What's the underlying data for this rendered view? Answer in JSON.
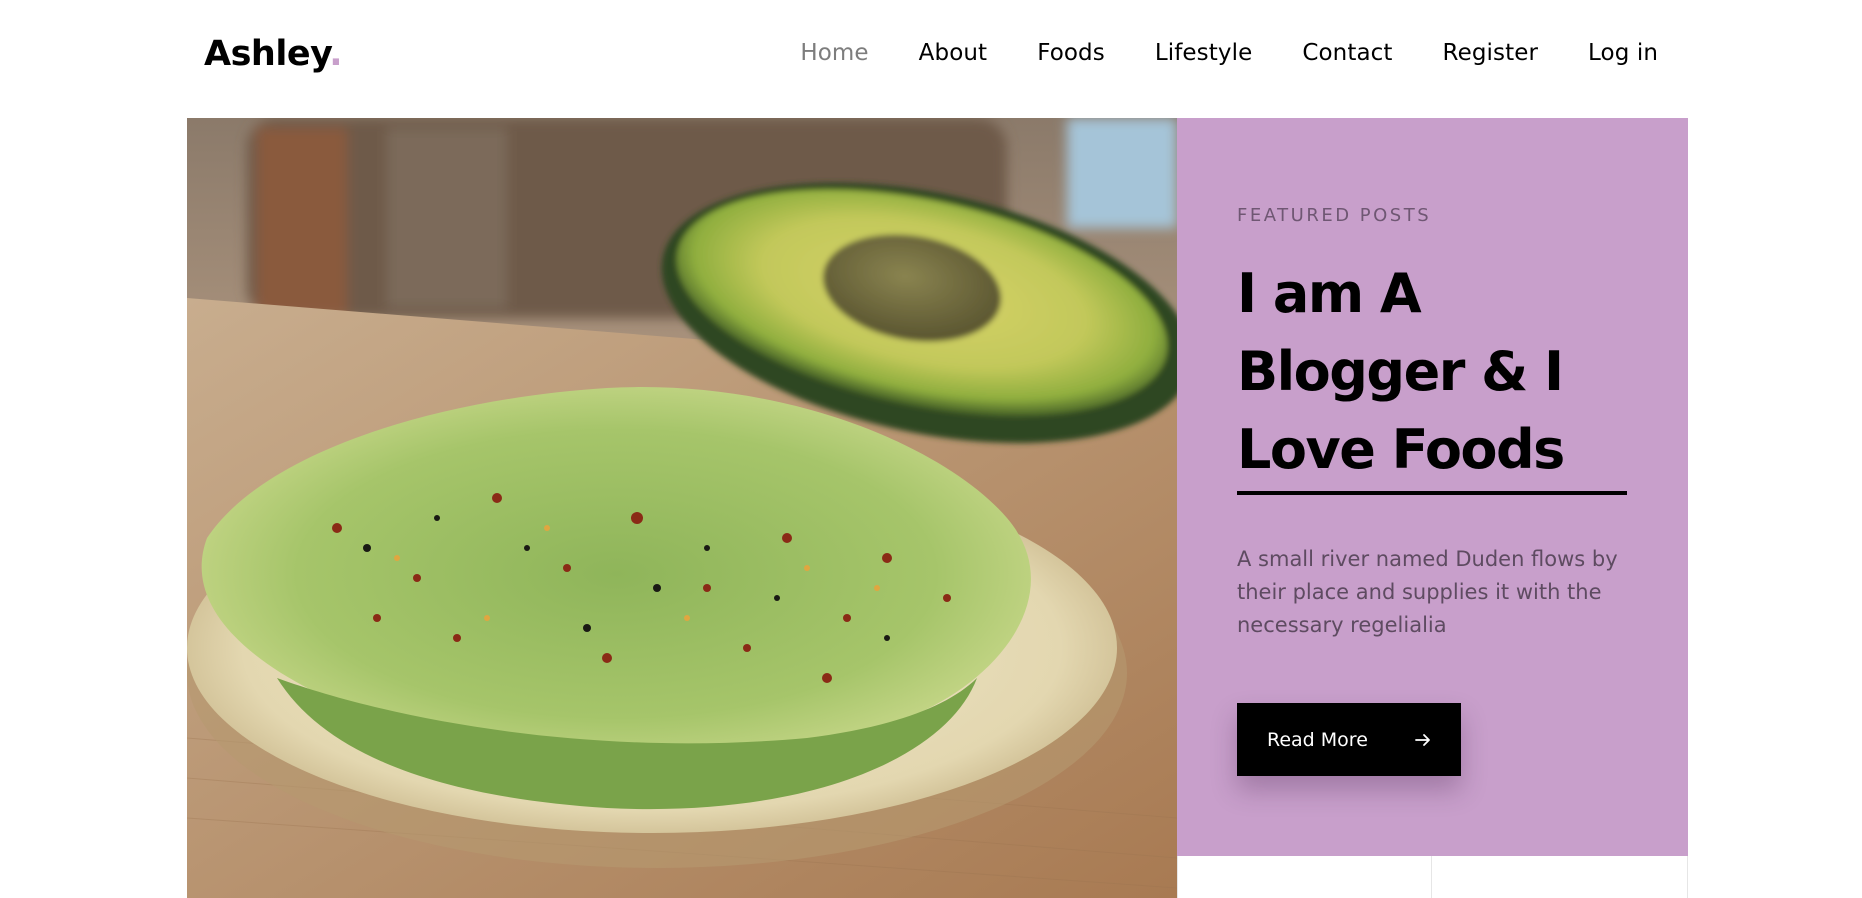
{
  "brand": {
    "name": "Ashley",
    "dot": ".",
    "accent_color": "#c89fcb"
  },
  "nav": {
    "items": [
      {
        "label": "Home",
        "active": true
      },
      {
        "label": "About"
      },
      {
        "label": "Foods"
      },
      {
        "label": "Lifestyle"
      },
      {
        "label": "Contact"
      },
      {
        "label": "Register"
      },
      {
        "label": "Log in"
      }
    ]
  },
  "hero": {
    "image_icon": "avocado-toast-photo",
    "kicker": "FEATURED POSTS",
    "title_lines": [
      "I am A",
      "Blogger & I",
      "Love Foods"
    ],
    "description": "A small river named Duden flows by their place and supplies it with the necessary regelialia",
    "button": {
      "label": "Read More",
      "icon": "arrow-right-icon"
    },
    "panel_color": "#c89fcb"
  }
}
